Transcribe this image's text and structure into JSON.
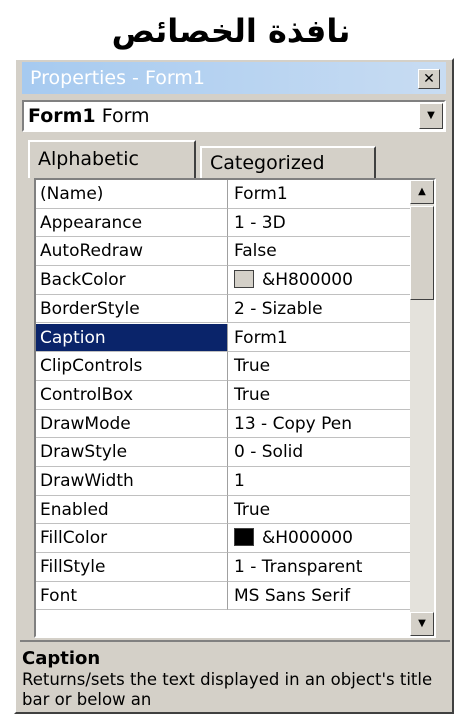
{
  "heading": "نافذة الخصائص",
  "window": {
    "title": "Properties - Form1",
    "close_glyph": "✕"
  },
  "object_selector": {
    "name": "Form1",
    "type": "Form"
  },
  "tabs": [
    {
      "label": "Alphabetic"
    },
    {
      "label": "Categorized"
    }
  ],
  "properties": [
    {
      "name": "(Name)",
      "value": "Form1"
    },
    {
      "name": "Appearance",
      "value": "1 - 3D"
    },
    {
      "name": "AutoRedraw",
      "value": "False"
    },
    {
      "name": "BackColor",
      "value": "&H800000",
      "swatch": "#d4d0c8"
    },
    {
      "name": "BorderStyle",
      "value": "2 - Sizable"
    },
    {
      "name": "Caption",
      "value": "Form1",
      "selected": true
    },
    {
      "name": "ClipControls",
      "value": "True"
    },
    {
      "name": "ControlBox",
      "value": "True"
    },
    {
      "name": "DrawMode",
      "value": "13 - Copy Pen"
    },
    {
      "name": "DrawStyle",
      "value": "0 - Solid"
    },
    {
      "name": "DrawWidth",
      "value": "1"
    },
    {
      "name": "Enabled",
      "value": "True"
    },
    {
      "name": "FillColor",
      "value": "&H000000",
      "swatch": "#000000"
    },
    {
      "name": "FillStyle",
      "value": "1 - Transparent"
    },
    {
      "name": "Font",
      "value": "MS Sans Serif"
    }
  ],
  "description": {
    "title": "Caption",
    "text": "Returns/sets the text displayed in an object's title bar or below an"
  },
  "colors": {
    "selection": "#0a246a",
    "face": "#d4d0c8"
  }
}
